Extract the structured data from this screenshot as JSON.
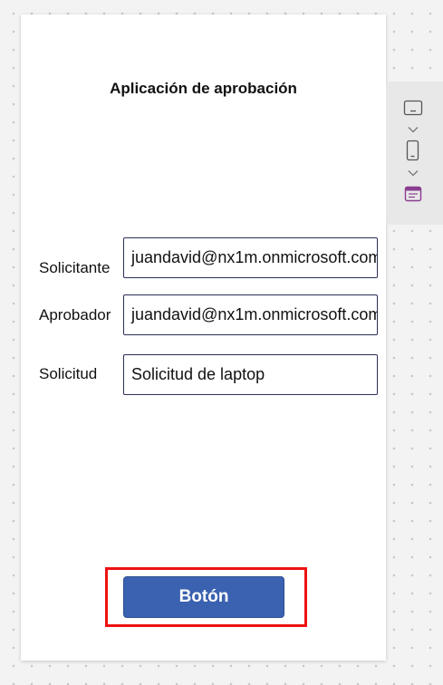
{
  "app": {
    "title": "Aplicación de aprobación"
  },
  "form": {
    "requester_label": "Solicitante",
    "requester_value": "juandavid@nx1m.onmicrosoft.com",
    "approver_label": "Aprobador",
    "approver_value": "juandavid@nx1m.onmicrosoft.com",
    "request_label": "Solicitud",
    "request_value": "Solicitud de laptop"
  },
  "button": {
    "label": "Botón"
  },
  "side_panel": {
    "icons": [
      "tablet-layout-icon",
      "chevron-down-icon",
      "phone-layout-icon",
      "chevron-down-icon",
      "app-calendar-icon"
    ]
  },
  "colors": {
    "button_fill": "#3b62b0",
    "highlight": "#ee1111",
    "field_border": "#2b2f57",
    "app_icon_accent": "#8a3d8f"
  }
}
